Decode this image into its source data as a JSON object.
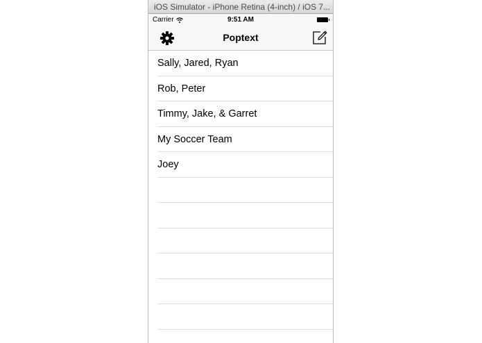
{
  "window": {
    "title": "iOS Simulator - iPhone Retina (4-inch) / iOS 7..."
  },
  "status_bar": {
    "carrier": "Carrier",
    "time": "9:51 AM"
  },
  "nav_bar": {
    "title": "Poptext",
    "left_icon": "gear-icon",
    "right_icon": "compose-icon"
  },
  "conversations": [
    "Sally, Jared, Ryan",
    "Rob, Peter",
    "Timmy, Jake, & Garret",
    "My Soccer Team",
    "Joey",
    "",
    "",
    "",
    "",
    "",
    "",
    ""
  ]
}
